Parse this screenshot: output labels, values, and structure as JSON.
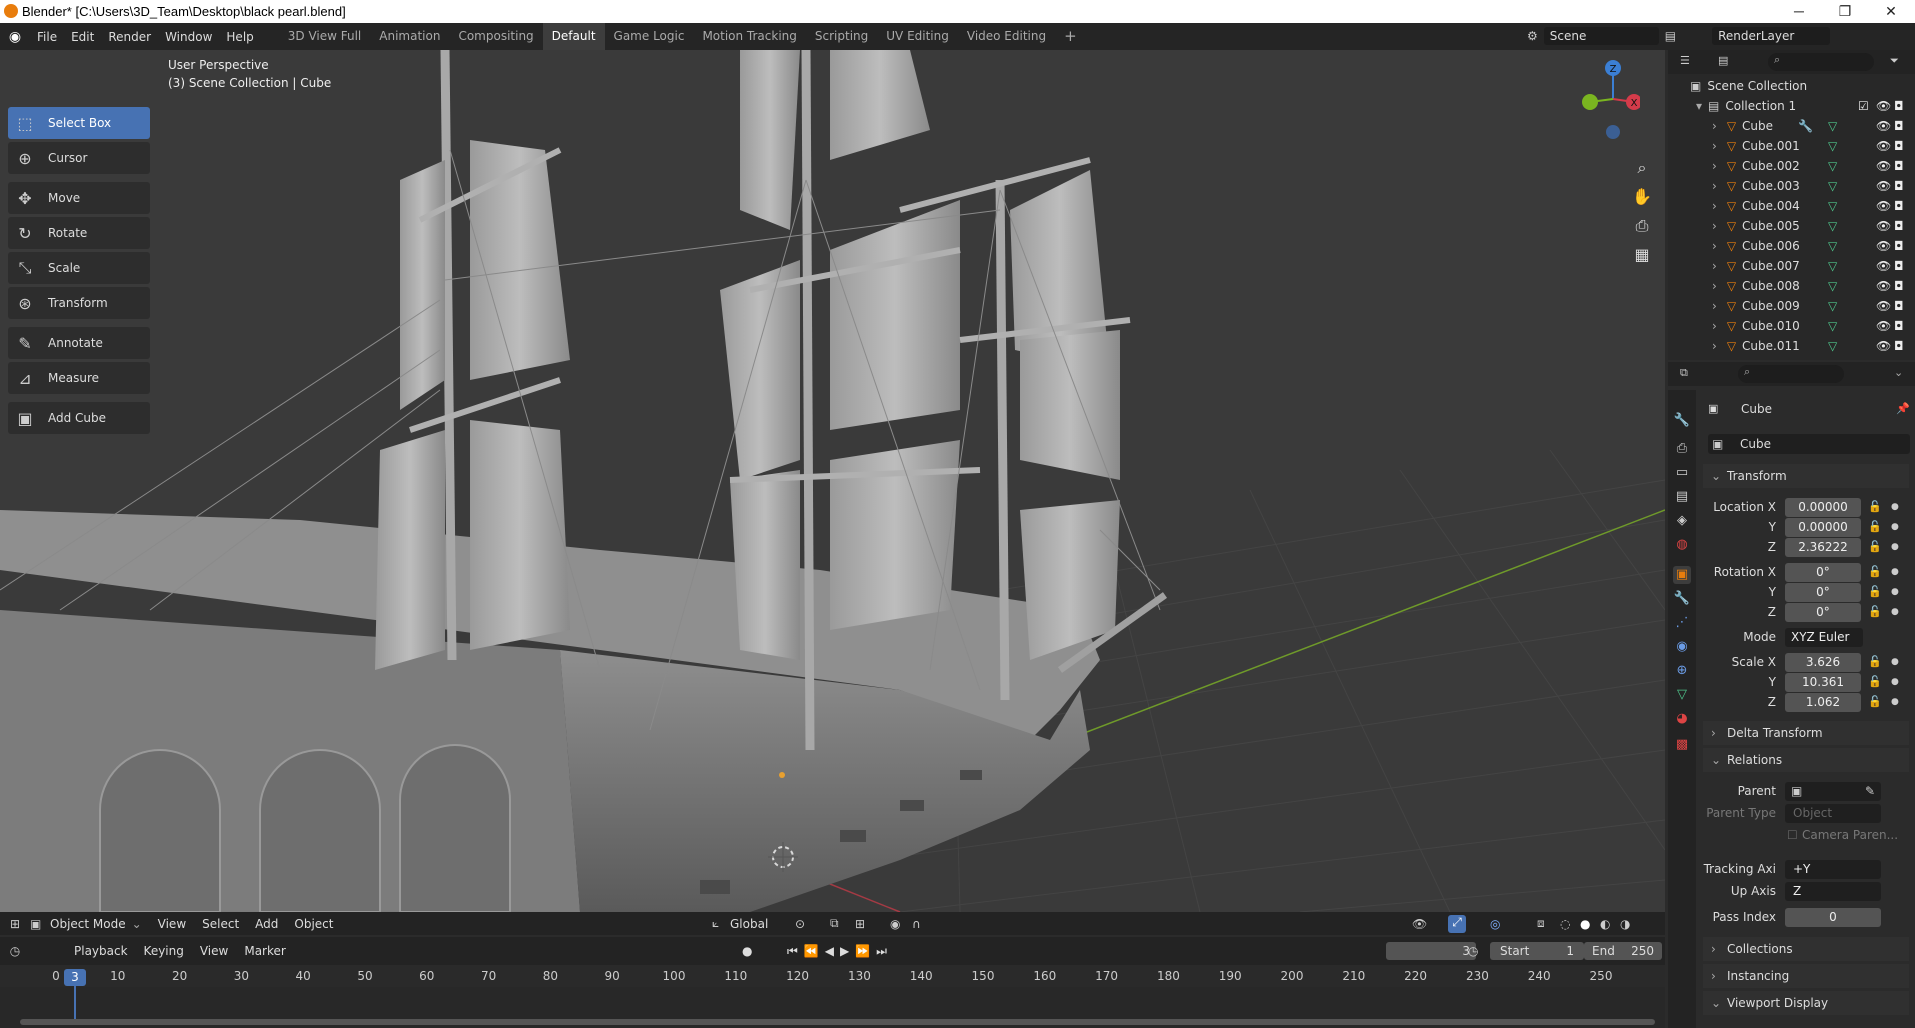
{
  "window": {
    "title": "Blender* [C:\\Users\\3D_Team\\Desktop\\black pearl.blend]",
    "min": "─",
    "restore": "❐",
    "close": "✕"
  },
  "menu": [
    "File",
    "Edit",
    "Render",
    "Window",
    "Help"
  ],
  "workspaces": [
    "3D View Full",
    "Animation",
    "Compositing",
    "Default",
    "Game Logic",
    "Motion Tracking",
    "Scripting",
    "UV Editing",
    "Video Editing"
  ],
  "add_workspace": "+",
  "scene": {
    "label": "Scene",
    "renderlayer": "RenderLayer"
  },
  "tools": [
    {
      "label": "Select Box",
      "icon": "select-box-icon",
      "glyph": "⬚",
      "active": true
    },
    {
      "label": "Cursor",
      "icon": "cursor-icon",
      "glyph": "⊕"
    },
    {
      "label": "Move",
      "icon": "move-icon",
      "glyph": "✥"
    },
    {
      "label": "Rotate",
      "icon": "rotate-icon",
      "glyph": "↻"
    },
    {
      "label": "Scale",
      "icon": "scale-icon",
      "glyph": "⤡"
    },
    {
      "label": "Transform",
      "icon": "transform-icon",
      "glyph": "⊛"
    },
    {
      "label": "Annotate",
      "icon": "annotate-icon",
      "glyph": "✎"
    },
    {
      "label": "Measure",
      "icon": "measure-icon",
      "glyph": "📐"
    },
    {
      "label": "Add Cube",
      "icon": "add-cube-icon",
      "glyph": "▣"
    }
  ],
  "viewport": {
    "perspective": "User Perspective",
    "collection": "(3) Scene Collection | Cube",
    "gizmo": {
      "z": "Z",
      "x": "X"
    }
  },
  "viewport_header": {
    "mode": "Object Mode",
    "menu": [
      "View",
      "Select",
      "Add",
      "Object"
    ],
    "orientation": "Global"
  },
  "timeline_header": {
    "menu": [
      "Playback",
      "Keying",
      "View",
      "Marker"
    ],
    "current_frame": "3",
    "start_label": "Start",
    "start": "1",
    "end_label": "End",
    "end": "250"
  },
  "timeline": {
    "current": "3",
    "ticks": [
      "0",
      "10",
      "20",
      "30",
      "40",
      "50",
      "60",
      "70",
      "80",
      "90",
      "100",
      "110",
      "120",
      "130",
      "140",
      "150",
      "160",
      "170",
      "180",
      "190",
      "200",
      "210",
      "220",
      "230",
      "240",
      "250"
    ]
  },
  "outliner": {
    "root": "Scene Collection",
    "collection": "Collection 1",
    "objects": [
      "Cube",
      "Cube.001",
      "Cube.002",
      "Cube.003",
      "Cube.004",
      "Cube.005",
      "Cube.006",
      "Cube.007",
      "Cube.008",
      "Cube.009",
      "Cube.010",
      "Cube.011"
    ]
  },
  "properties": {
    "object_name": "Cube",
    "object_field": "Cube",
    "transform": {
      "title": "Transform",
      "location_label": "Location X",
      "location": [
        "0.00000",
        "0.00000",
        "2.36222"
      ],
      "rotation_label": "Rotation X",
      "rotation": [
        "0°",
        "0°",
        "0°"
      ],
      "mode_label": "Mode",
      "mode": "XYZ Euler",
      "scale_label": "Scale X",
      "scale": [
        "3.626",
        "10.361",
        "1.062"
      ],
      "y": "Y",
      "z": "Z"
    },
    "delta": "Delta Transform",
    "relations": {
      "title": "Relations",
      "parent_label": "Parent",
      "parent_type_label": "Parent Type",
      "parent_type": "Object",
      "camera_parent": "Camera Paren...",
      "tracking_label": "Tracking Axi",
      "tracking": "+Y",
      "up_label": "Up Axis",
      "up": "Z",
      "pass_label": "Pass Index",
      "pass": "0"
    },
    "collections": "Collections",
    "instancing": "Instancing",
    "viewport_display": "Viewport Display"
  },
  "colors": {
    "accent": "#4772b3",
    "object": "#e87d0d",
    "mesh": "#4fc48b",
    "axis_x": "#d43b4a",
    "axis_y": "#7ab520",
    "axis_z": "#3b7fd4"
  }
}
